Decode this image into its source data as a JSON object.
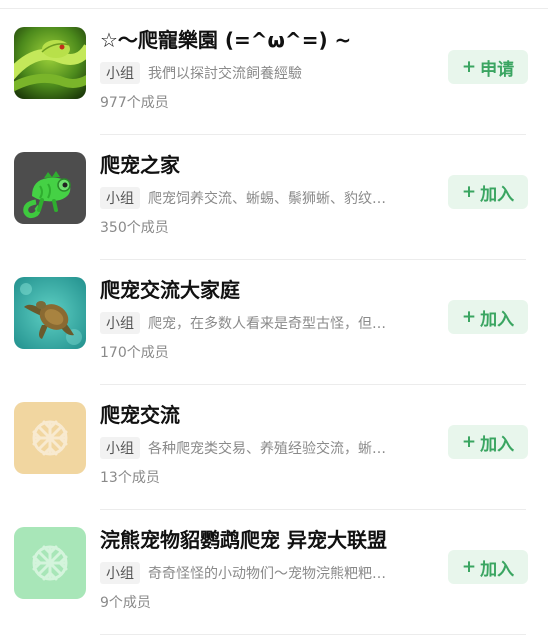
{
  "groups": [
    {
      "title": "☆～爬寵樂園 (=^ω^=) ~",
      "tag": "小组",
      "description": "我們以探討交流飼養經驗",
      "members": "977个成员",
      "action_plus": "+",
      "action_label": "申请",
      "avatar": "green-snake-photo"
    },
    {
      "title": "爬宠之家",
      "tag": "小组",
      "description": "爬宠饲养交流、蜥蜴、鬃狮蜥、豹纹…",
      "members": "350个成员",
      "action_plus": "+",
      "action_label": "加入",
      "avatar": "chameleon-icon"
    },
    {
      "title": "爬宠交流大家庭",
      "tag": "小组",
      "description": "爬宠，在多数人看来是奇型古怪，但…",
      "members": "170个成员",
      "action_plus": "+",
      "action_label": "加入",
      "avatar": "sea-turtle-photo"
    },
    {
      "title": "爬宠交流",
      "tag": "小组",
      "description": "各种爬宠类交易、养殖经验交流，蜥…",
      "members": "13个成员",
      "action_plus": "+",
      "action_label": "加入",
      "avatar": "default-group-icon"
    },
    {
      "title": "浣熊宠物貂鹦鹉爬宠 异宠大联盟",
      "tag": "小组",
      "description": "奇奇怪怪的小动物们～宠物浣熊粑粑…",
      "members": "9个成员",
      "action_plus": "+",
      "action_label": "加入",
      "avatar": "default-group-icon"
    }
  ],
  "colors": {
    "accent": "#3aa561",
    "button_bg": "#e8f6ec",
    "default_avatar_tan": "#f1d6a0",
    "default_avatar_green": "#a8e6b8"
  }
}
